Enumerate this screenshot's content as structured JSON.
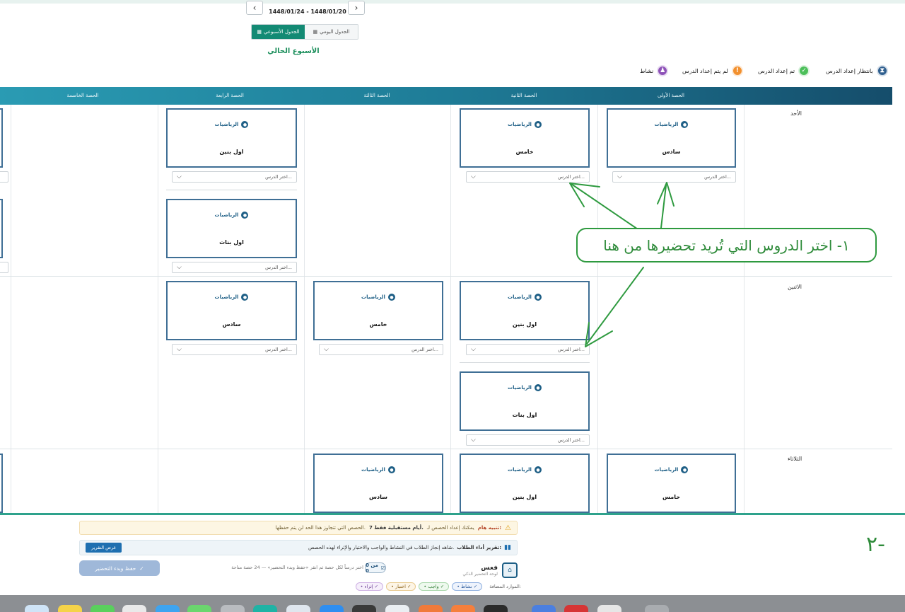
{
  "header": {
    "date_range": "1448/01/24 - 1448/01/20",
    "prev_icon": "chevron-left-icon",
    "next_icon": "chevron-right-icon",
    "view_daily": "الجدول اليومي",
    "view_weekly": "الجدول الأسبوعي",
    "week_title": "الأسبوع الحالي"
  },
  "legend": [
    {
      "label": "بانتظار إعداد الدرس",
      "color": "#2f5f8f",
      "icon": "hourglass-icon"
    },
    {
      "label": "تم إعداد الدرس",
      "color": "#4cbf5a",
      "icon": "check-icon"
    },
    {
      "label": "لم يتم إعداد الدرس",
      "color": "#f2902e",
      "icon": "exclamation-icon"
    },
    {
      "label": "نشاط",
      "color": "#8e52b8",
      "icon": "activity-icon"
    }
  ],
  "table": {
    "headers": [
      "الحصة الأولى",
      "الحصة الثانية",
      "الحصة الثالثة",
      "الحصة الرابعة",
      "الحصة الخامسة"
    ],
    "days": [
      "الأحد",
      "الاثنين",
      "الثلاثاء"
    ],
    "subject": "الرياضيات",
    "select_placeholder": "اختر الدرس...",
    "classes": {
      "sunday_p1": "سادس",
      "sunday_p2": "خامس",
      "sunday_p4a": "اول بنين",
      "sunday_p4b": "اول بنات",
      "monday_p2a": "اول بنين",
      "monday_p2b": "اول بنات",
      "monday_p3": "خامس",
      "monday_p4": "سادس",
      "tuesday_p1": "خامس",
      "tuesday_p2": "اول بنين",
      "tuesday_p3": "سادس"
    }
  },
  "annotation": {
    "callout": "١- اختر الدروس التي تُريد تحضيرها من هنا",
    "step2": "٢-",
    "color": "#2e9a3f"
  },
  "bottom": {
    "notice_label": "تنبيه هام:",
    "notice_text": "يمكنك إعداد الحصص لـ",
    "notice_days": "7 أيام مستقبلية فقط.",
    "notice_tail": "الحصص التي تتجاوز هذا الحد لن يتم حفظها.",
    "report_label": "تقرير أداء الطلاب:",
    "report_text": "شاهد إنجاز الطلاب في النشاط والواجب والاختبار والإثراء لهذه الحصص.",
    "report_button": "عرض التقرير",
    "save_button": "حفظ وبدء التحضير",
    "counter_text": "0 من 0",
    "hint": "اختر درساً لكل حصة ثم انقر «حفظ وبدء التحضير» — 24 حصة متاحة",
    "teacher_name": "فعس",
    "teacher_sub": "لوحة التحضير الذكي",
    "resources_label": "الموارد المضافة:",
    "chips": [
      "• نشاط ✓",
      "• واجب ✓",
      "• اختبار ✓",
      "• إثراء ✓"
    ]
  }
}
